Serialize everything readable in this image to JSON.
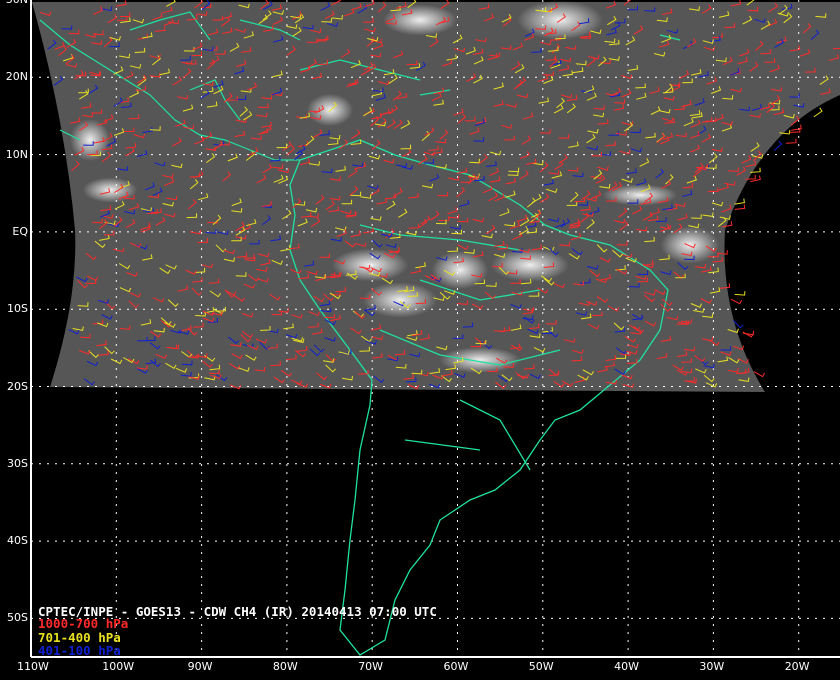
{
  "title": "CPTEC/INPE - GOES13 - CDW CH4 (IR) 20140413 07:00 UTC",
  "legend": [
    {
      "label": "1000-700 hPa",
      "color": "#ff2a2a"
    },
    {
      "label": "701-400 hPa",
      "color": "#e8e020"
    },
    {
      "label": "401-100 hPa",
      "color": "#1020d0"
    }
  ],
  "lat_labels": [
    "30N",
    "20N",
    "10N",
    "EQ",
    "10S",
    "20S",
    "30S",
    "40S",
    "50S"
  ],
  "lon_labels": [
    "110W",
    "100W",
    "90W",
    "80W",
    "70W",
    "60W",
    "50W",
    "40W",
    "30W",
    "20W"
  ],
  "colors": {
    "coast": "#20e0a0",
    "grid": "#ffffff",
    "swath": "#555555"
  }
}
